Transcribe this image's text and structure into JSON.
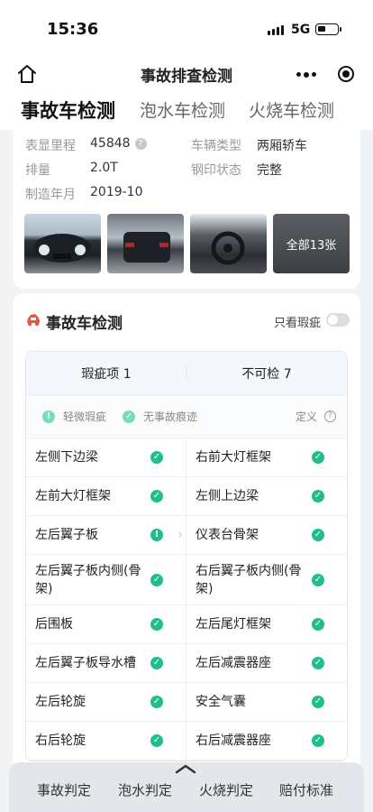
{
  "status_bar": {
    "time": "15:36",
    "network": "5G"
  },
  "nav": {
    "title": "事故排查检测"
  },
  "tabs": [
    {
      "label": "事故车检测",
      "active": true
    },
    {
      "label": "泡水车检测",
      "active": false
    },
    {
      "label": "火烧车检测",
      "active": false
    }
  ],
  "vehicle_info": {
    "mileage_label": "表显里程",
    "mileage_value": "45848",
    "type_label": "车辆类型",
    "type_value": "两厢轿车",
    "displacement_label": "排量",
    "displacement_value": "2.0T",
    "stamp_label": "钢印状态",
    "stamp_value": "完整",
    "date_label": "制造年月",
    "date_value": "2019-10",
    "all_photos": "全部13张"
  },
  "detect": {
    "title": "事故车检测",
    "only_flaws_label": "只看瑕疵",
    "summary_flaws": "瑕疵项 1",
    "summary_uncheckable": "不可检 7",
    "legend_minor": "轻微瑕疵",
    "legend_none": "无事故痕迹",
    "legend_define": "定义",
    "items": [
      [
        "左侧下边梁",
        "右前大灯框架"
      ],
      [
        "左前大灯框架",
        "左侧上边梁"
      ],
      [
        "左后翼子板",
        "仪表台骨架"
      ],
      [
        "左后翼子板内侧(骨架)",
        "右后翼子板内侧(骨架)"
      ],
      [
        "后围板",
        "左后尾灯框架"
      ],
      [
        "左后翼子板导水槽",
        "左后减震器座"
      ],
      [
        "左后轮旋",
        "安全气囊"
      ],
      [
        "右后轮旋",
        "右后减震器座"
      ]
    ]
  },
  "bottom_nav": [
    "事故判定",
    "泡水判定",
    "火烧判定",
    "赔付标准"
  ],
  "colors": {
    "ok_green": "#20c084",
    "accent": "#111111"
  }
}
